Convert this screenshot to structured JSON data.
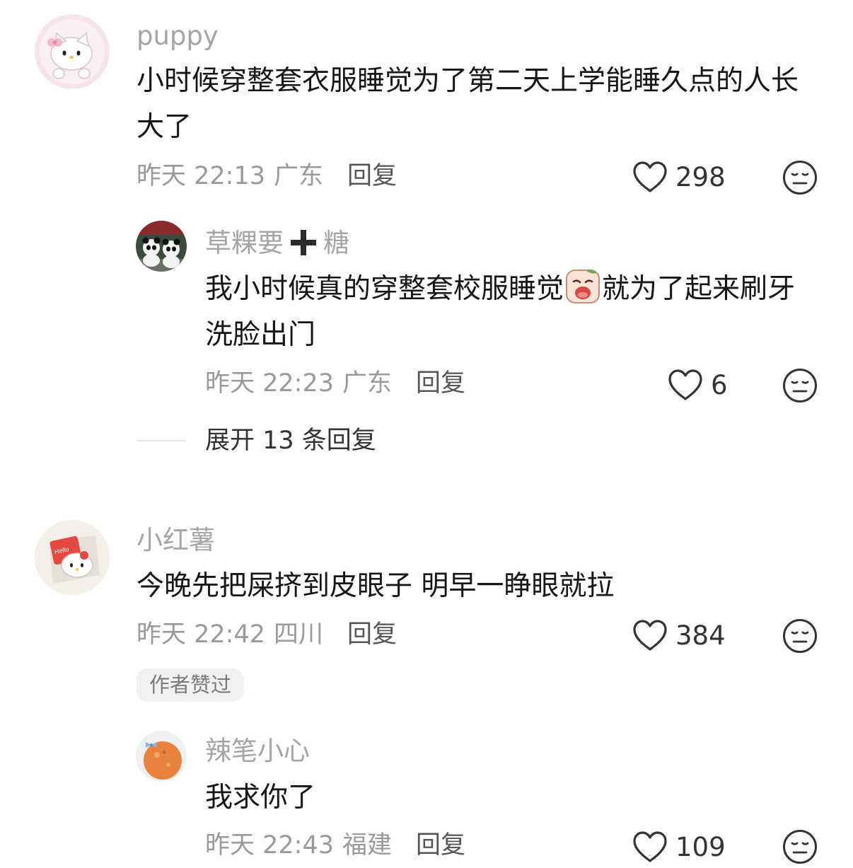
{
  "comments": [
    {
      "username": "puppy",
      "avatar": "hello-kitty-pink-avatar",
      "text": "小时候穿整套衣服睡觉为了第二天上学能睡久点的人长大了",
      "time": "昨天 22:13",
      "location": "广东",
      "reply_label": "回复",
      "likes": "298",
      "replies": [
        {
          "username_part1": "草粿要",
          "username_part2": "糖",
          "avatar": "panda-photo-avatar",
          "text_before": "我小时候真的穿整套校服睡觉",
          "emoji": "crying-face-emoji",
          "text_after": "就为了起来刷牙洗脸出门",
          "time": "昨天 22:23",
          "location": "广东",
          "reply_label": "回复",
          "likes": "6"
        }
      ],
      "expand_label": "展开 13 条回复"
    },
    {
      "username": "小红薯",
      "avatar": "hello-kitty-sticker-avatar",
      "text": "今晚先把屎挤到皮眼子 明早一睁眼就拉",
      "time": "昨天 22:42",
      "location": "四川",
      "reply_label": "回复",
      "likes": "384",
      "badge": "作者赞过",
      "replies": [
        {
          "username": "辣笔小心",
          "avatar": "orange-ball-avatar",
          "text": "我求你了",
          "time": "昨天 22:43",
          "location": "福建",
          "reply_label": "回复",
          "likes": "109"
        }
      ]
    }
  ],
  "colors": {
    "username": "#a5a5a5",
    "text": "#161616",
    "meta": "#9a9a9a",
    "background": "#ffffff"
  }
}
